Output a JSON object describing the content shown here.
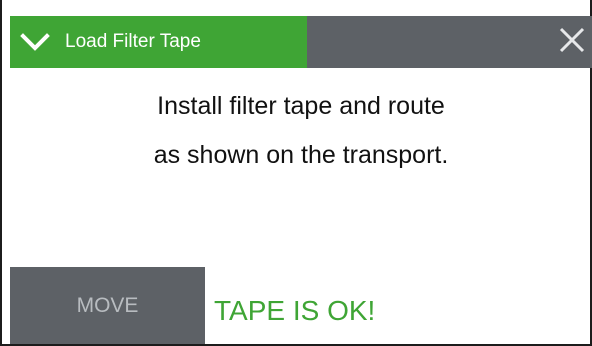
{
  "header": {
    "title": "Load Filter Tape",
    "expand_icon": "chevron-down-icon",
    "close_icon": "close-icon"
  },
  "message": {
    "line1": "Install filter tape and route",
    "line2": "as shown on the transport."
  },
  "actions": {
    "move_label": "MOVE"
  },
  "status": {
    "text": "TAPE IS OK!"
  },
  "colors": {
    "accent_green": "#3fa535",
    "header_gray": "#5d6166",
    "button_text": "#b8bcc0",
    "status_green": "#3fa535"
  }
}
